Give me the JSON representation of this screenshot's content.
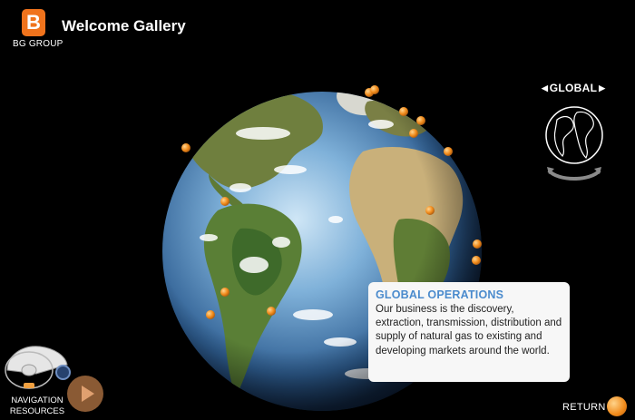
{
  "header": {
    "logo_text": "BG GROUP",
    "logo_letter": "B",
    "title": "Welcome Gallery"
  },
  "global_selector": {
    "label": "GLOBAL",
    "prev_icon": "left-arrow",
    "next_icon": "right-arrow"
  },
  "info_card": {
    "title": "GLOBAL OPERATIONS",
    "body": "Our business is the discovery, extraction, transmission, distribution and supply of natural gas to existing and developing markets around the world."
  },
  "navigation": {
    "line1": "NAVIGATION",
    "line2": "RESOURCES"
  },
  "return_label": "RETURN",
  "colors": {
    "brand_orange": "#f0731c",
    "card_title_blue": "#4b8bcd",
    "background": "#000000"
  }
}
